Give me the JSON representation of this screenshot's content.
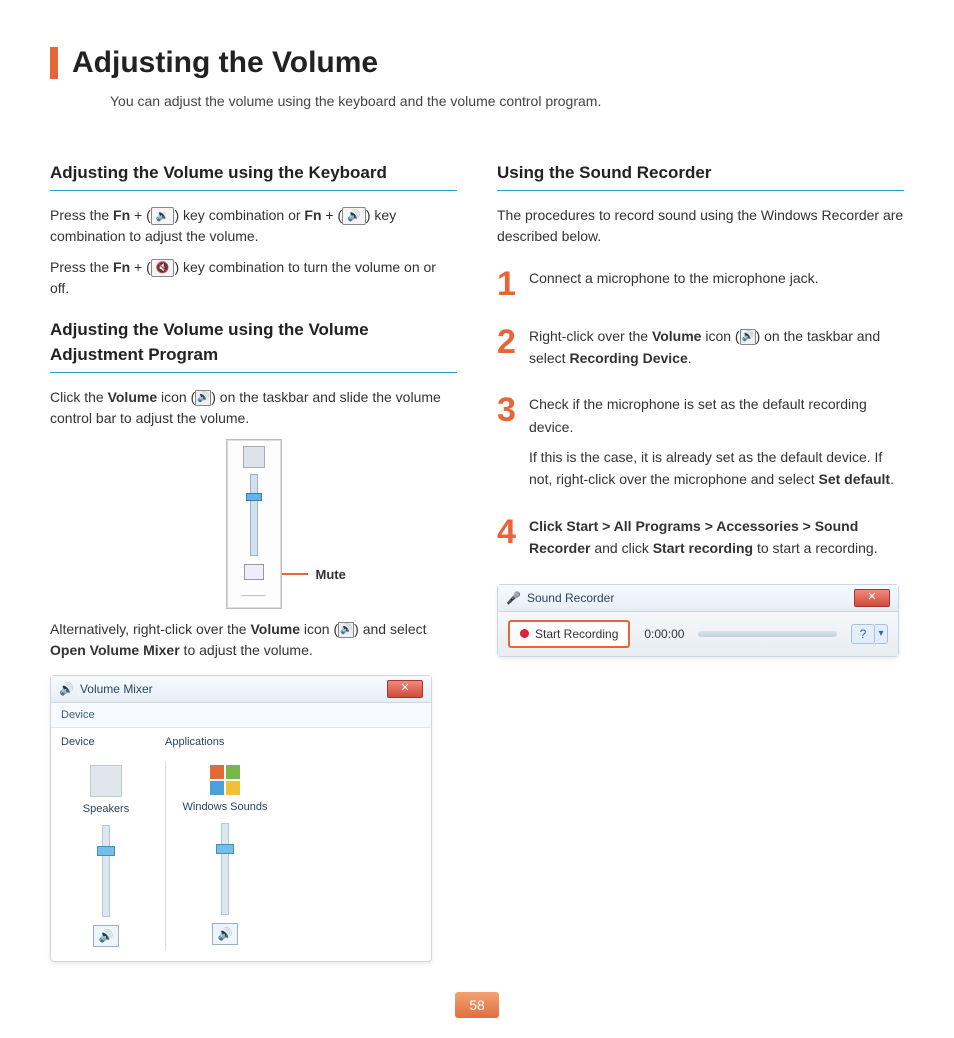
{
  "title": "Adjusting the Volume",
  "intro": "You can adjust the volume using the keyboard and the volume control program.",
  "left": {
    "heading1": "Adjusting the Volume using the Keyboard",
    "p1_a": "Press the ",
    "p1_fn": "Fn",
    "p1_b": " + (",
    "p1_c": ") key combination or ",
    "p1_d": " + (",
    "p1_e": ") key combination to adjust the volume.",
    "p2_a": "Press the ",
    "p2_b": " + (",
    "p2_c": ") key combination to turn the volume on or off.",
    "heading2": "Adjusting the Volume using the Volume Adjustment Program",
    "p3_a": "Click the ",
    "p3_vol": "Volume",
    "p3_b": " icon (",
    "p3_c": ") on the taskbar and slide the volume control bar to adjust the volume.",
    "mute_label": "Mute",
    "p4_a": "Alternatively, right-click over the ",
    "p4_b": " icon (",
    "p4_c": ") and select ",
    "p4_open": "Open Volume Mixer",
    "p4_d": " to adjust the volume.",
    "mixer": {
      "title": "Volume Mixer",
      "device_tab": "Device",
      "header_device": "Device",
      "header_apps": "Applications",
      "col1": "Speakers",
      "col2": "Windows Sounds"
    }
  },
  "right": {
    "heading": "Using the Sound Recorder",
    "intro": "The procedures to record sound using the Windows Recorder are described below.",
    "steps": {
      "s1": "Connect a microphone to the microphone jack.",
      "s2_a": "Right-click over the ",
      "s2_vol": "Volume",
      "s2_b": " icon (",
      "s2_c": ") on the taskbar and select ",
      "s2_rec": "Recording Device",
      "s2_d": ".",
      "s3_a": "Check if the microphone is set as the default recording device.",
      "s3_b": "If this is the case, it is already set as the default device. If not, right-click over the microphone and select ",
      "s3_set": "Set default",
      "s3_c": ".",
      "s4_a": "Click Start > All Programs > Accessories > Sound Recorder",
      "s4_b": " and click ",
      "s4_start": "Start recording",
      "s4_c": " to start a recording."
    },
    "recorder": {
      "title": "Sound Recorder",
      "button": "Start Recording",
      "time": "0:00:00"
    }
  },
  "page_number": "58"
}
